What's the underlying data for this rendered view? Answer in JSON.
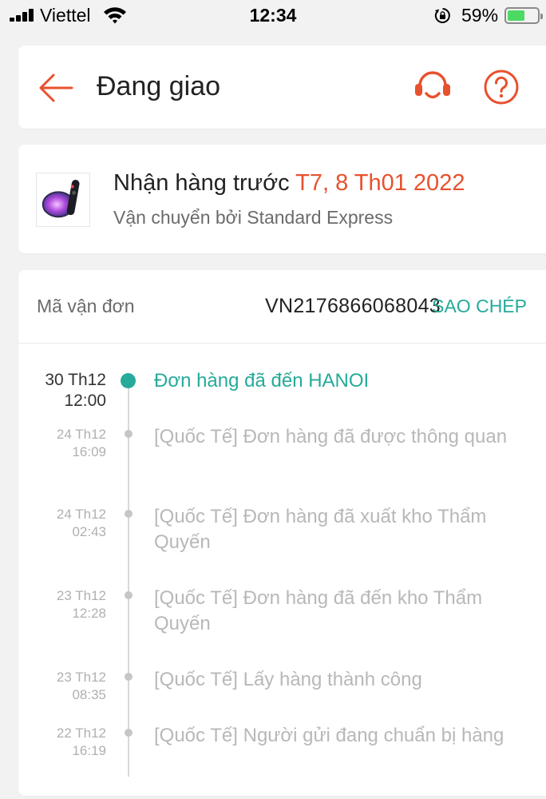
{
  "status_bar": {
    "carrier": "Viettel",
    "time": "12:34",
    "battery_percent": "59%",
    "battery_level": 0.59
  },
  "header": {
    "title": "Đang giao"
  },
  "delivery": {
    "eta_prefix": "Nhận hàng trước",
    "eta_date": "T7, 8 Th01 2022",
    "shipper": "Vận chuyển bởi Standard Express"
  },
  "tracking": {
    "label": "Mã vận đơn",
    "number": "VN2176866068043",
    "copy_label": "SAO CHÉP",
    "events": [
      {
        "date": "30 Th12",
        "time": "12:00",
        "text": "Đơn hàng đã đến HANOI",
        "active": true
      },
      {
        "date": "24 Th12",
        "time": "16:09",
        "text": "[Quốc Tế] Đơn hàng đã được thông quan",
        "active": false
      },
      {
        "date": "24 Th12",
        "time": "02:43",
        "text": "[Quốc Tế] Đơn hàng đã xuất kho Thẩm Quyến",
        "active": false
      },
      {
        "date": "23 Th12",
        "time": "12:28",
        "text": "[Quốc Tế] Đơn hàng đã đến kho Thẩm Quyến",
        "active": false
      },
      {
        "date": "23 Th12",
        "time": "08:35",
        "text": "[Quốc Tế] Lấy hàng thành công",
        "active": false
      },
      {
        "date": "22 Th12",
        "time": "16:19",
        "text": "[Quốc Tế] Người gửi đang chuẩn bị hàng",
        "active": false
      }
    ]
  },
  "colors": {
    "accent": "#e8512e",
    "teal": "#26aa99"
  }
}
